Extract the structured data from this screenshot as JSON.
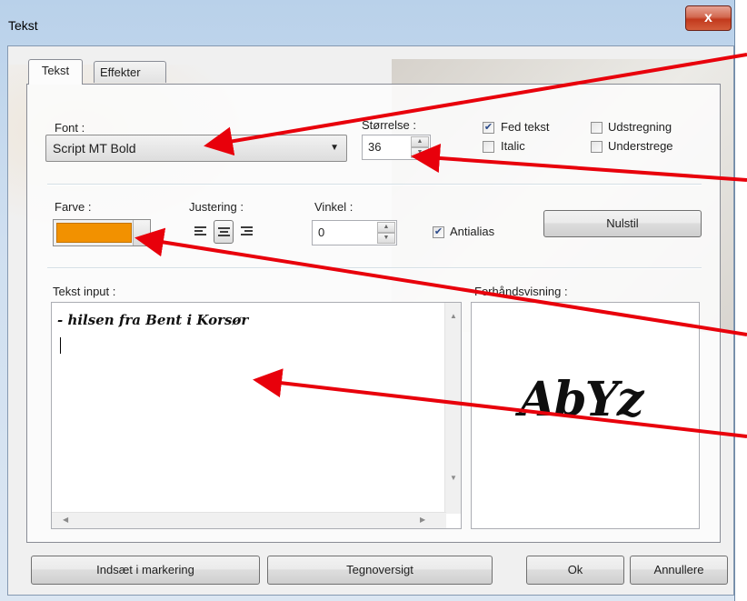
{
  "window": {
    "title": "Tekst",
    "close_label": "x"
  },
  "tabs": [
    {
      "label": "Tekst",
      "active": true
    },
    {
      "label": "Effekter",
      "active": false
    }
  ],
  "font": {
    "label": "Font :",
    "value": "Script MT Bold"
  },
  "size": {
    "label": "Størrelse :",
    "value": "36"
  },
  "style_options": [
    {
      "label": "Fed tekst",
      "checked": true
    },
    {
      "label": "Udstregning",
      "checked": false
    },
    {
      "label": "Italic",
      "checked": false
    },
    {
      "label": "Understrege",
      "checked": false
    }
  ],
  "color": {
    "label": "Farve :",
    "value": "#f29100"
  },
  "alignment": {
    "label": "Justering :",
    "options": [
      "left",
      "center",
      "right"
    ],
    "selected": "center"
  },
  "angle": {
    "label": "Vinkel :",
    "value": "0"
  },
  "antialias": {
    "label": "Antialias",
    "checked": true
  },
  "reset_button": "Nulstil",
  "text_input": {
    "label": "Tekst input :",
    "value": "- hilsen fra Bent i Korsør"
  },
  "preview": {
    "label": "Forhåndsvisning :",
    "sample": "AbYz"
  },
  "buttons": {
    "insert": "Indsæt i markering",
    "charmap": "Tegnoversigt",
    "ok": "Ok",
    "cancel": "Annullere"
  },
  "annotation_color": "#e8000b"
}
